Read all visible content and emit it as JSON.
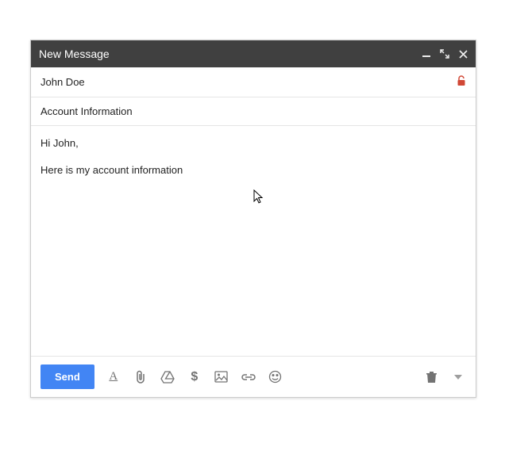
{
  "header": {
    "title": "New Message"
  },
  "fields": {
    "recipient": "John Doe",
    "subject": "Account Information"
  },
  "body": {
    "line1": "Hi John,",
    "line2": "Here is my account information"
  },
  "toolbar": {
    "send_label": "Send"
  }
}
